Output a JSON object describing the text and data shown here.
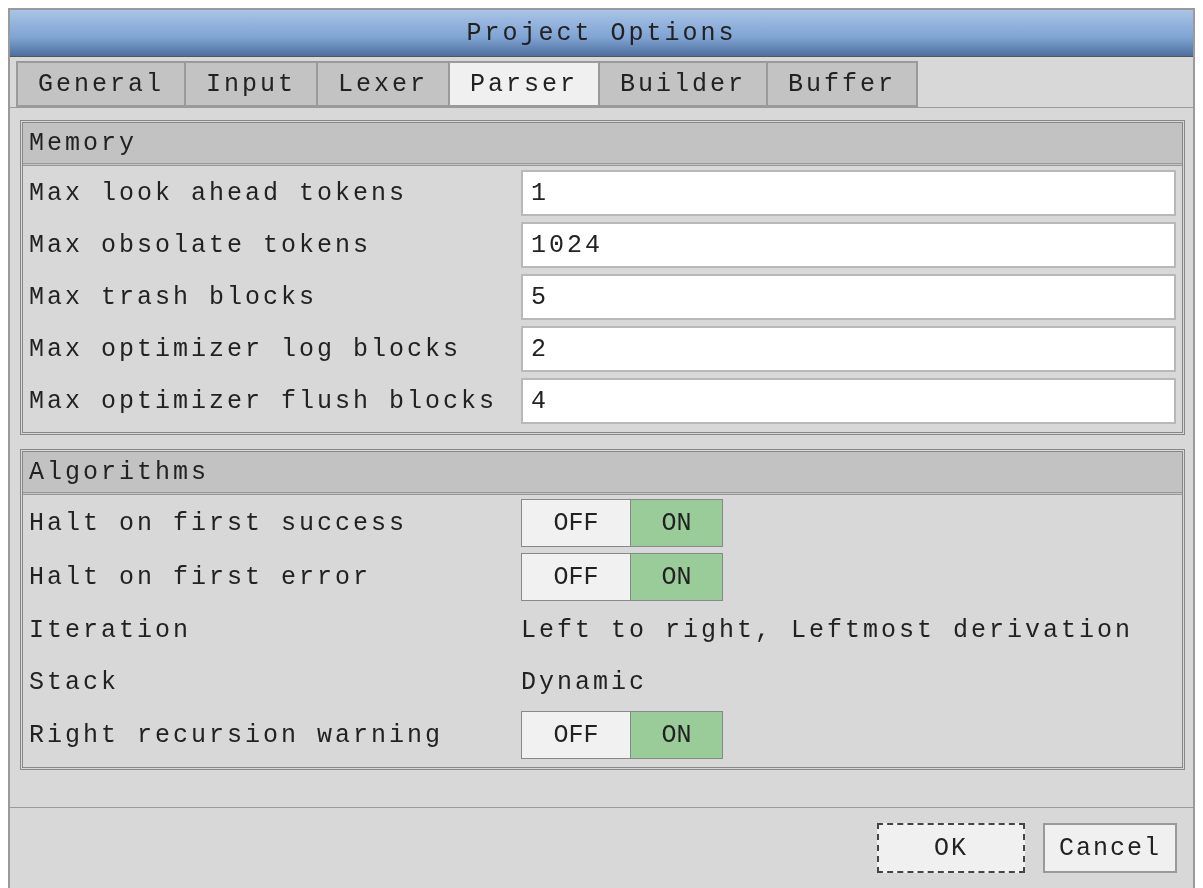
{
  "window": {
    "title": "Project Options"
  },
  "tabs": [
    {
      "label": "General",
      "selected": false
    },
    {
      "label": "Input",
      "selected": false
    },
    {
      "label": "Lexer",
      "selected": false
    },
    {
      "label": "Parser",
      "selected": true
    },
    {
      "label": "Builder",
      "selected": false
    },
    {
      "label": "Buffer",
      "selected": false
    }
  ],
  "groups": [
    {
      "title": "Memory",
      "rows": [
        {
          "kind": "field",
          "label": "Max look ahead tokens",
          "value": "1"
        },
        {
          "kind": "field",
          "label": "Max obsolate tokens",
          "value": "1024"
        },
        {
          "kind": "field",
          "label": "Max trash blocks",
          "value": "5"
        },
        {
          "kind": "field",
          "label": "Max optimizer log blocks",
          "value": "2"
        },
        {
          "kind": "field",
          "label": "Max optimizer flush blocks",
          "value": "4"
        }
      ]
    },
    {
      "title": "Algorithms",
      "rows": [
        {
          "kind": "toggle",
          "label": "Halt on first success",
          "options": [
            {
              "label": "OFF",
              "selected": false
            },
            {
              "label": "ON",
              "selected": true
            }
          ]
        },
        {
          "kind": "toggle",
          "label": "Halt on first error",
          "options": [
            {
              "label": "OFF",
              "selected": false
            },
            {
              "label": "ON",
              "selected": true
            }
          ]
        },
        {
          "kind": "text",
          "label": "Iteration",
          "value": "Left to right, Leftmost derivation"
        },
        {
          "kind": "text",
          "label": "Stack",
          "value": "Dynamic"
        },
        {
          "kind": "toggle",
          "label": "Right recursion warning",
          "options": [
            {
              "label": "OFF",
              "selected": false
            },
            {
              "label": "ON",
              "selected": true
            }
          ]
        }
      ]
    }
  ],
  "buttons": [
    {
      "label": "OK",
      "focused": true
    },
    {
      "label": "Cancel",
      "focused": false
    }
  ]
}
